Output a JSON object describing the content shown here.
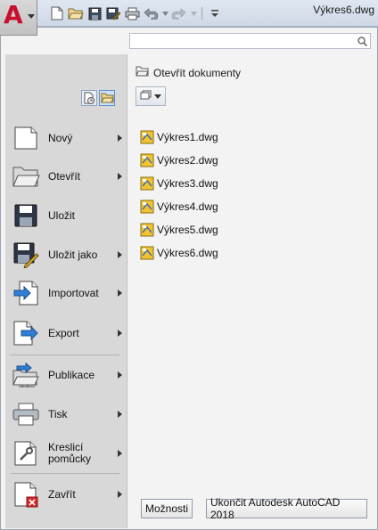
{
  "window": {
    "title": "Výkres6.dwg"
  },
  "app_button": {
    "logo_glyph": "A",
    "accent": "#c8102e"
  },
  "quick_access": {
    "items": [
      "new-icon",
      "open-icon",
      "save-icon",
      "save-as-icon",
      "print-icon",
      "undo-icon",
      "redo-icon",
      "customize-icon"
    ]
  },
  "search": {
    "placeholder": "",
    "value": ""
  },
  "commands": [
    {
      "label": "Nový",
      "has_arrow": true,
      "icon": "new-document-icon"
    },
    {
      "label": "Otevřít",
      "has_arrow": true,
      "icon": "open-folder-icon"
    },
    {
      "label": "Uložit",
      "has_arrow": false,
      "icon": "save-icon"
    },
    {
      "label": "Uložit jako",
      "has_arrow": true,
      "icon": "save-as-icon"
    },
    {
      "label": "Importovat",
      "has_arrow": true,
      "icon": "import-icon"
    },
    {
      "label": "Export",
      "has_arrow": true,
      "icon": "export-icon"
    },
    {
      "label": "Publikace",
      "has_arrow": true,
      "icon": "publish-icon"
    },
    {
      "label": "Tisk",
      "has_arrow": true,
      "icon": "print-icon"
    },
    {
      "label": "Kreslicí pomůcky",
      "has_arrow": true,
      "icon": "drawing-utilities-icon"
    },
    {
      "label": "Zavřít",
      "has_arrow": true,
      "icon": "close-document-icon"
    }
  ],
  "right_panel": {
    "header": "Otevřít dokumenty",
    "files": [
      "Výkres1.dwg",
      "Výkres2.dwg",
      "Výkres3.dwg",
      "Výkres4.dwg",
      "Výkres5.dwg",
      "Výkres6.dwg"
    ]
  },
  "footer": {
    "options_label": "Možnosti",
    "exit_label": "Ukončit Autodesk AutoCAD 2018"
  }
}
